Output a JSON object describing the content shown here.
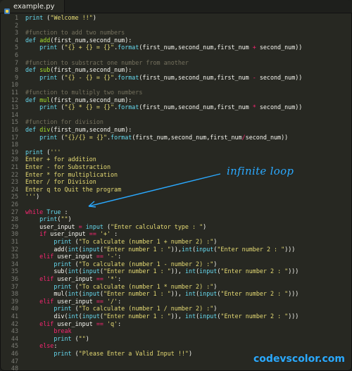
{
  "tab": {
    "filename": "example.py",
    "icon": "python-file-icon"
  },
  "annotation": "infinite loop",
  "watermark": "codevscolor.com",
  "colors": {
    "keyword": "#66d9ef",
    "string": "#e6db74",
    "comment": "#75715e",
    "function": "#a6e22e",
    "accent": "#2aa9ff"
  },
  "lines": [
    "print (\"Welcome !!\")",
    "",
    "#function to add two numbers",
    "def add(first_num,second_num):",
    "    print (\"{} + {} = {}\".format(first_num,second_num,first_num + second_num))",
    "",
    "#function to substract one number from another",
    "def sub(first_num,second_num):",
    "    print (\"{} - {} = {}\".format(first_num,second_num,first_num - second_num))",
    "",
    "#function to multiply two numbers",
    "def mul(first_num,second_num):",
    "    print (\"{} * {} = {}\".format(first_num,second_num,first_num * second_num))",
    "",
    "#function for division",
    "def div(first_num,second_num):",
    "    print (\"{}/{} = {}\".format(first_num,second_num,first_num/second_num))",
    "",
    "print ('''",
    "Enter + for addition",
    "Enter - for Substraction",
    "Enter * for multiplication",
    "Enter / for Division",
    "Enter q to Quit the program",
    "''')",
    "",
    "while True :",
    "    print(\"\")",
    "    user_input = input (\"Enter calculator type : \")",
    "    if user_input == '+' :",
    "        print (\"To calculate (number 1 + number 2) :\")",
    "        add(int(input(\"Enter number 1 : \")),int(input(\"Enter number 2 : \")))",
    "    elif user_input == '-':",
    "        print (\"To calculate (number 1 - number 2) :\")",
    "        sub(int(input(\"Enter number 1 : \")), int(input(\"Enter number 2 : \")))",
    "    elif user_input == '*':",
    "        print (\"To calculate (number 1 * number 2) :\")",
    "        mul(int(input(\"Enter number 1 : \")), int(input(\"Enter number 2 : \")))",
    "    elif user_input == '/':",
    "        print (\"To calculate (number 1 / number 2) :\")",
    "        div(int(input(\"Enter number 1 : \")), int(input(\"Enter number 2 : \")))",
    "    elif user_input == 'q':",
    "        break",
    "        print (\"\")",
    "    else:",
    "        print (\"Please Enter a Valid Input !!\")",
    "",
    ""
  ]
}
